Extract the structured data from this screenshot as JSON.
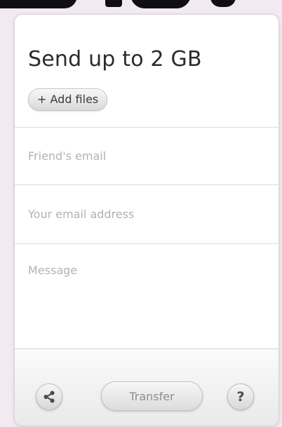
{
  "widget": {
    "title": "Send up to 2 GB",
    "add_files_icon": "plus-icon",
    "add_files_label": "+ Add files"
  },
  "form": {
    "friend_email_placeholder": "Friend's email",
    "your_email_placeholder": "Your email address",
    "message_placeholder": "Message"
  },
  "footer": {
    "share_icon": "share-icon",
    "transfer_label": "Transfer",
    "help_icon": "help-icon",
    "help_glyph": "?"
  }
}
